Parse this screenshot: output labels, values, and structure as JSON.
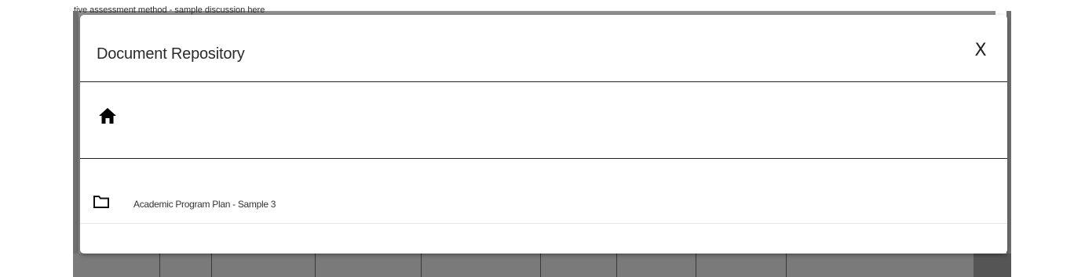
{
  "background": {
    "partial_text": "tive assessment method - sample discussion here"
  },
  "modal": {
    "title": "Document Repository",
    "close_label": "X"
  },
  "toolbar": {
    "home_icon": "home-icon"
  },
  "repository": {
    "items": [
      {
        "type": "folder",
        "icon": "folder-icon",
        "label": "Academic Program Plan - Sample 3"
      }
    ]
  }
}
